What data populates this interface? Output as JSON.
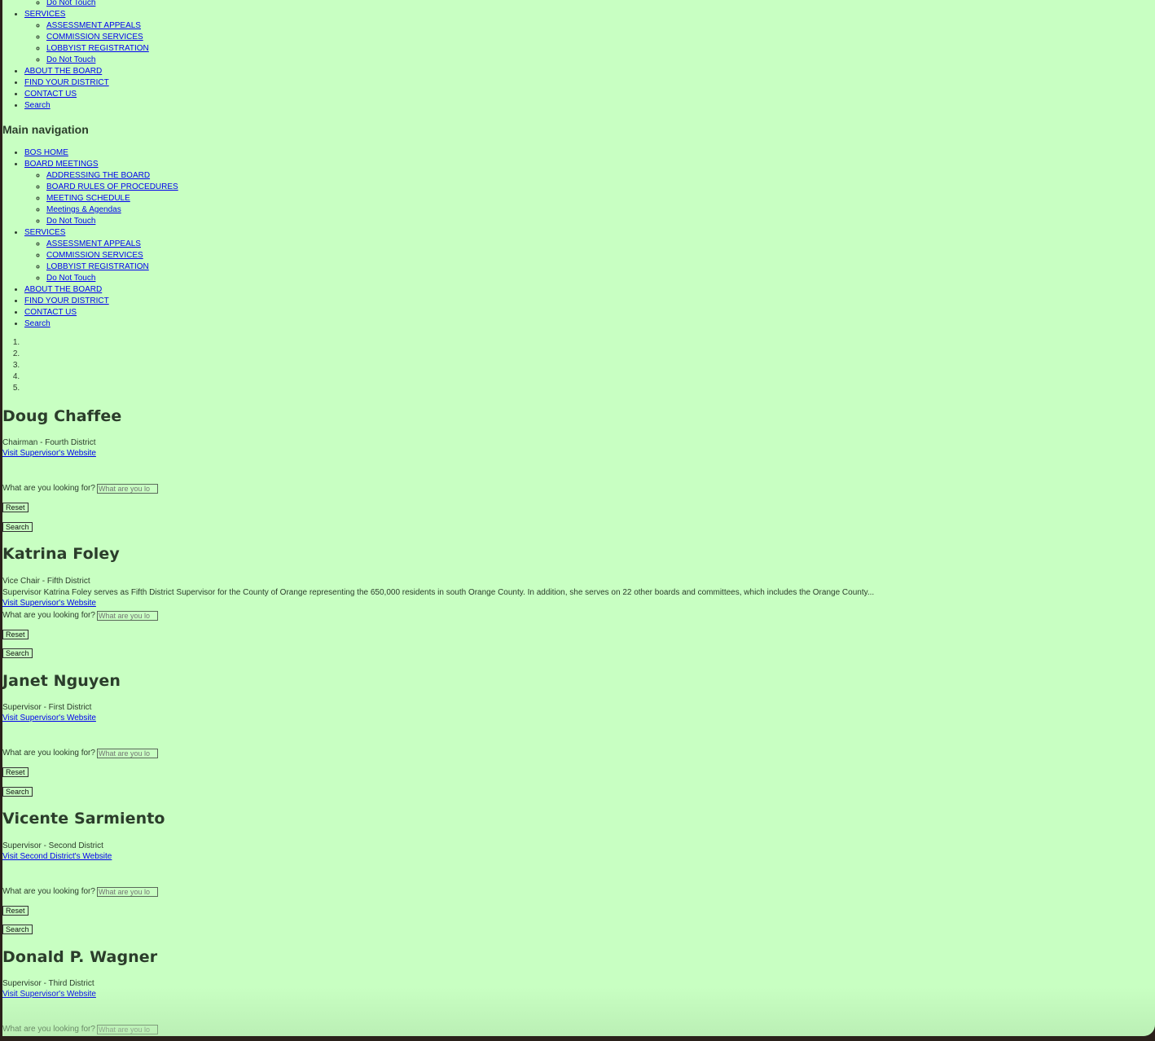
{
  "top_nav_partial": {
    "leading_item": "Do Not Touch",
    "services": {
      "label": "SERVICES",
      "children": [
        "ASSESSMENT APPEALS",
        "COMMISSION SERVICES",
        "LOBBYIST REGISTRATION",
        "Do Not Touch"
      ]
    },
    "items": [
      "ABOUT THE BOARD",
      "FIND YOUR DISTRICT",
      "CONTACT US",
      "Search"
    ]
  },
  "main_nav": {
    "heading": "Main navigation",
    "bos_home": "BOS HOME",
    "board_meetings": {
      "label": "BOARD MEETINGS",
      "children": [
        "ADDRESSING THE BOARD",
        "BOARD RULES OF PROCEDURES",
        "MEETING SCHEDULE",
        "Meetings & Agendas",
        "Do Not Touch"
      ]
    },
    "services": {
      "label": "SERVICES",
      "children": [
        "ASSESSMENT APPEALS",
        "COMMISSION SERVICES",
        "LOBBYIST REGISTRATION",
        "Do Not Touch"
      ]
    },
    "items": [
      "ABOUT THE BOARD",
      "FIND YOUR DISTRICT",
      "CONTACT US",
      "Search"
    ]
  },
  "breadcrumb_count": 5,
  "search_form": {
    "label": "What are you looking for?",
    "placeholder": "What are you lo",
    "reset_label": "Reset",
    "search_label": "Search"
  },
  "supervisors": [
    {
      "name": "Doug Chaffee",
      "title": "Chairman - Fourth District",
      "link": "Visit Supervisor's Website"
    },
    {
      "name": "Katrina Foley",
      "title": "Vice Chair - Fifth District",
      "bio": "Supervisor Katrina Foley serves as Fifth District Supervisor for the County of Orange representing the 650,000 residents in south Orange County. In addition, she serves on 22 other boards and committees, which includes the Orange County...",
      "link": "Visit Supervisor's Website"
    },
    {
      "name": "Janet Nguyen",
      "title": "Supervisor - First District",
      "link": "Visit Supervisor's Website"
    },
    {
      "name": "Vicente Sarmiento",
      "title": "Supervisor - Second District",
      "link": "Visit Second District's Website"
    },
    {
      "name": "Donald P. Wagner",
      "title": "Supervisor - Third District",
      "link": "Visit Supervisor's Website"
    }
  ]
}
